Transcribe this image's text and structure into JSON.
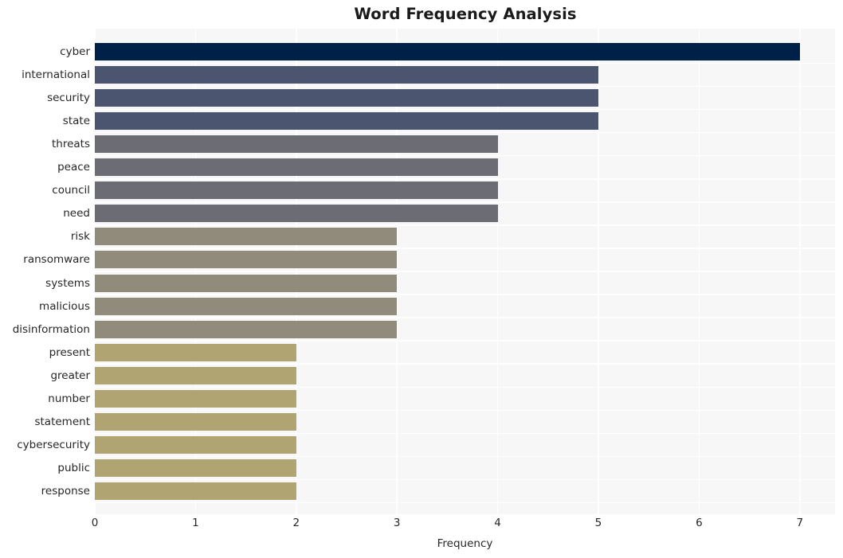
{
  "chart_data": {
    "type": "bar",
    "orientation": "horizontal",
    "title": "Word Frequency Analysis",
    "xlabel": "Frequency",
    "ylabel": "",
    "xlim": [
      0,
      7.35
    ],
    "ylim": [
      0,
      20
    ],
    "grid": true,
    "legend": null,
    "xticks": [
      "0",
      "1",
      "2",
      "3",
      "4",
      "5",
      "6",
      "7"
    ],
    "xtick_values": [
      0,
      1,
      2,
      3,
      4,
      5,
      6,
      7
    ],
    "categories": [
      "cyber",
      "international",
      "security",
      "state",
      "threats",
      "peace",
      "council",
      "need",
      "risk",
      "ransomware",
      "systems",
      "malicious",
      "disinformation",
      "present",
      "greater",
      "number",
      "statement",
      "cybersecurity",
      "public",
      "response"
    ],
    "values": [
      7,
      5,
      5,
      5,
      4,
      4,
      4,
      4,
      3,
      3,
      3,
      3,
      3,
      2,
      2,
      2,
      2,
      2,
      2,
      2
    ],
    "bar_colors": [
      "#002147",
      "#4c556f",
      "#4c556f",
      "#4c556f",
      "#6c6d74",
      "#6c6d74",
      "#6c6d74",
      "#6c6d74",
      "#908b7b",
      "#908b7b",
      "#908b7b",
      "#908b7b",
      "#908b7b",
      "#afa472",
      "#afa472",
      "#afa472",
      "#afa472",
      "#afa472",
      "#afa472",
      "#afa472"
    ]
  },
  "style": {
    "figure_background": "#ffffff",
    "plot_background": "#f7f7f7",
    "gridline_color": "#ffffff",
    "text_color": "#262626",
    "title_color": "#1a1a1a"
  }
}
